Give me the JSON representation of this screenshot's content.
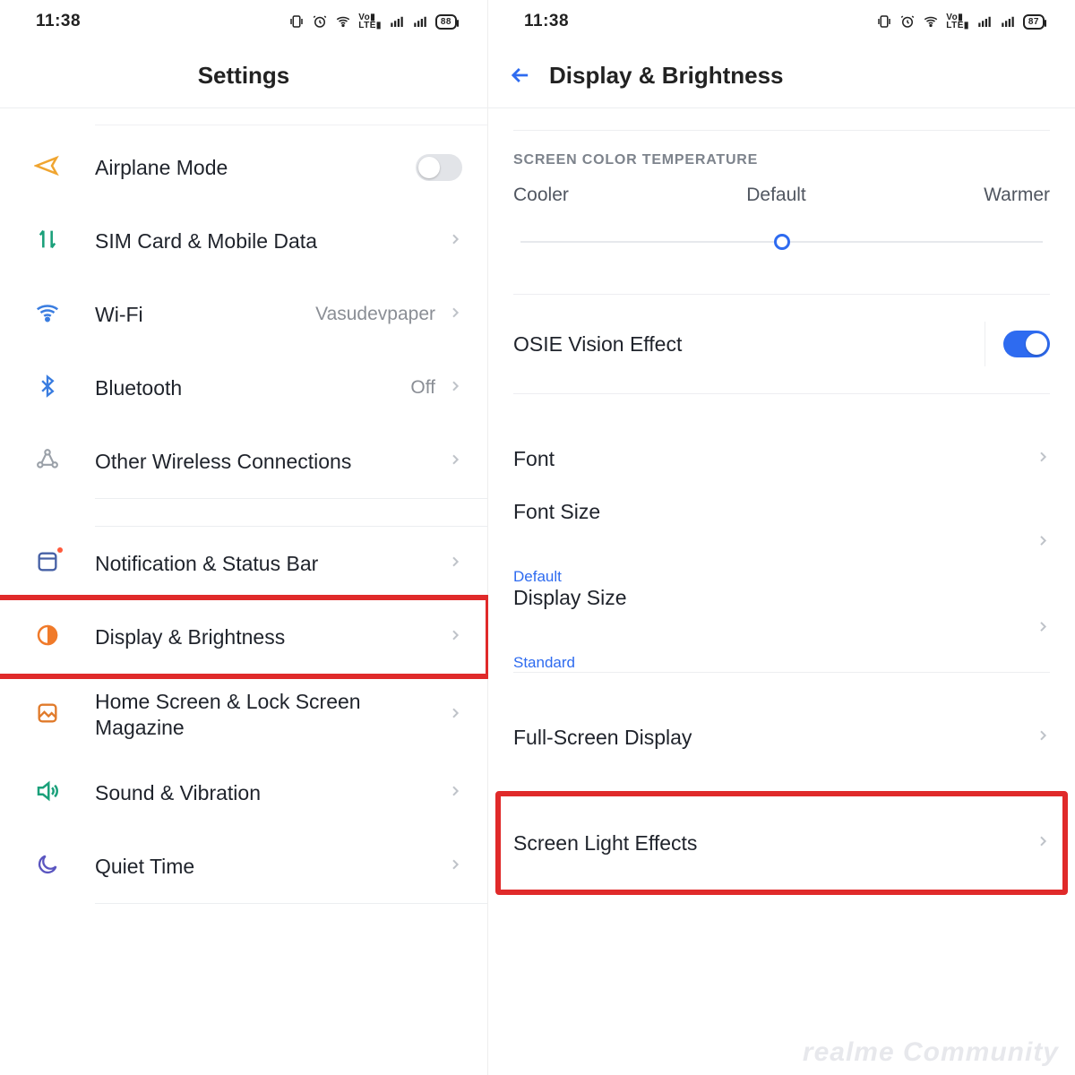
{
  "left": {
    "status": {
      "time": "11:38",
      "battery": "88"
    },
    "title": "Settings",
    "rows": [
      {
        "id": "airplane",
        "label": "Airplane Mode",
        "icon": "airplane",
        "type": "toggle",
        "on": false
      },
      {
        "id": "sim",
        "label": "SIM Card & Mobile Data",
        "icon": "sim",
        "type": "nav"
      },
      {
        "id": "wifi",
        "label": "Wi-Fi",
        "icon": "wifi",
        "type": "nav",
        "value": "Vasudevpaper"
      },
      {
        "id": "bt",
        "label": "Bluetooth",
        "icon": "bt",
        "type": "nav",
        "value": "Off"
      },
      {
        "id": "owc",
        "label": "Other Wireless Connections",
        "icon": "owc",
        "type": "nav"
      },
      {
        "id": "notif",
        "label": "Notification & Status Bar",
        "icon": "notif",
        "type": "nav"
      },
      {
        "id": "display",
        "label": "Display & Brightness",
        "icon": "display",
        "type": "nav",
        "highlight": true
      },
      {
        "id": "home",
        "label": "Home Screen & Lock Screen Magazine",
        "icon": "home",
        "type": "nav"
      },
      {
        "id": "sound",
        "label": "Sound & Vibration",
        "icon": "sound",
        "type": "nav"
      },
      {
        "id": "quiet",
        "label": "Quiet Time",
        "icon": "quiet",
        "type": "nav"
      }
    ]
  },
  "right": {
    "status": {
      "time": "11:38",
      "battery": "87"
    },
    "title": "Display & Brightness",
    "colorTemp": {
      "section": "SCREEN COLOR TEMPERATURE",
      "labels": [
        "Cooler",
        "Default",
        "Warmer"
      ],
      "valuePct": 50
    },
    "osie": {
      "label": "OSIE Vision Effect",
      "on": true
    },
    "rows": [
      {
        "id": "font",
        "label": "Font"
      },
      {
        "id": "fontsize",
        "label": "Font Size",
        "sub": "Default"
      },
      {
        "id": "dispsize",
        "label": "Display Size",
        "sub": "Standard"
      },
      {
        "id": "fulldisp",
        "label": "Full-Screen Display"
      },
      {
        "id": "lighteff",
        "label": "Screen Light Effects",
        "highlight": true
      }
    ],
    "watermark": "realme Community"
  }
}
